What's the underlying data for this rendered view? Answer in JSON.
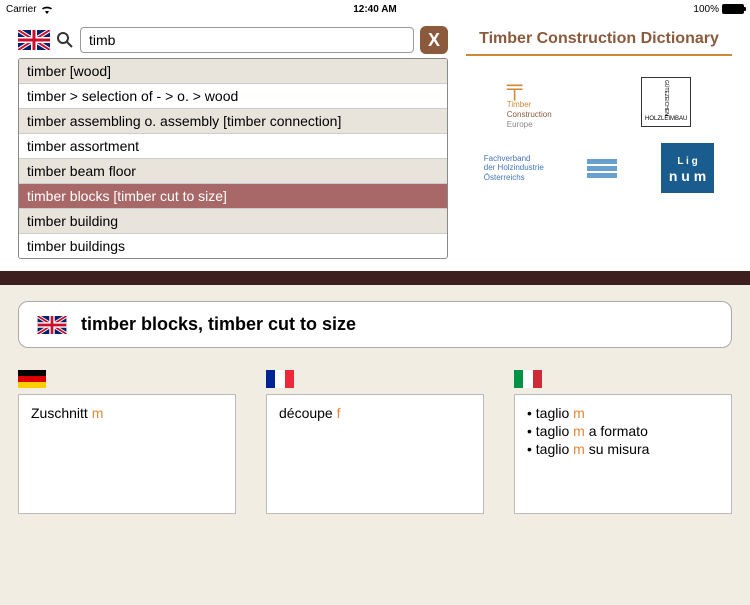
{
  "status": {
    "carrier": "Carrier",
    "time": "12:40 AM",
    "battery": "100%"
  },
  "search": {
    "query": "timb",
    "clear_label": "X"
  },
  "results": [
    {
      "text": "timber  [wood]",
      "selected": false
    },
    {
      "text": "timber > selection of  - > o. > wood",
      "selected": false
    },
    {
      "text": "timber assembling o. assembly  [timber connection]",
      "selected": false
    },
    {
      "text": "timber assortment",
      "selected": false
    },
    {
      "text": "timber beam floor",
      "selected": false
    },
    {
      "text": "timber blocks  [timber cut to size]",
      "selected": true
    },
    {
      "text": "timber building",
      "selected": false
    },
    {
      "text": "timber buildings",
      "selected": false
    }
  ],
  "app_title": "Timber Construction Dictionary",
  "logos": {
    "tce_line1": "Timber",
    "tce_line2": "Construction",
    "tce_line3": "Europe",
    "holz": "HOLZLEIMBAU",
    "holz2": "GÜTEZEICHEN",
    "fach_line1": "Fachverband",
    "fach_line2": "der Holzindustrie",
    "fach_line3": "Österreichs",
    "lignum_text": "Lignum"
  },
  "selected_term": "timber blocks, timber cut to size",
  "translations": {
    "de": [
      {
        "pre": "Zuschnitt ",
        "gender": "m",
        "post": ""
      }
    ],
    "fr": [
      {
        "pre": "découpe ",
        "gender": "f",
        "post": ""
      }
    ],
    "it": [
      {
        "pre": "• taglio ",
        "gender": "m",
        "post": ""
      },
      {
        "pre": "• taglio ",
        "gender": "m",
        "post": " a formato"
      },
      {
        "pre": "• taglio ",
        "gender": "m",
        "post": " su misura"
      }
    ]
  }
}
